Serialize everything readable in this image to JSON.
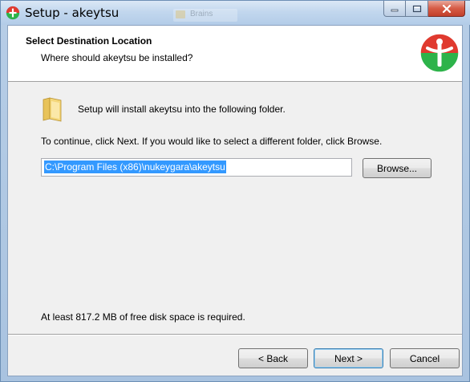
{
  "window": {
    "title": "Setup - akeytsu",
    "background_item": "Brains"
  },
  "header": {
    "title": "Select Destination Location",
    "subtitle": "Where should akeytsu be installed?"
  },
  "body": {
    "intro_text": "Setup will install akeytsu into the following folder.",
    "instruction_text": "To continue, click Next. If you would like to select a different folder, click Browse.",
    "install_path": "C:\\Program Files (x86)\\nukeygara\\akeytsu",
    "browse_label": "Browse...",
    "disk_space_text": "At least 817.2 MB of free disk space is required."
  },
  "footer": {
    "back_label": "< Back",
    "next_label": "Next >",
    "cancel_label": "Cancel"
  },
  "icons": {
    "app": "akeytsu-logo-icon",
    "folder": "folder-icon",
    "minimize": "minimize-icon",
    "maximize": "maximize-icon",
    "close": "close-icon"
  },
  "colors": {
    "selection": "#3399ff",
    "logo_red": "#e03a2f",
    "logo_green": "#2db34a",
    "logo_blue": "#2f7fd0"
  }
}
